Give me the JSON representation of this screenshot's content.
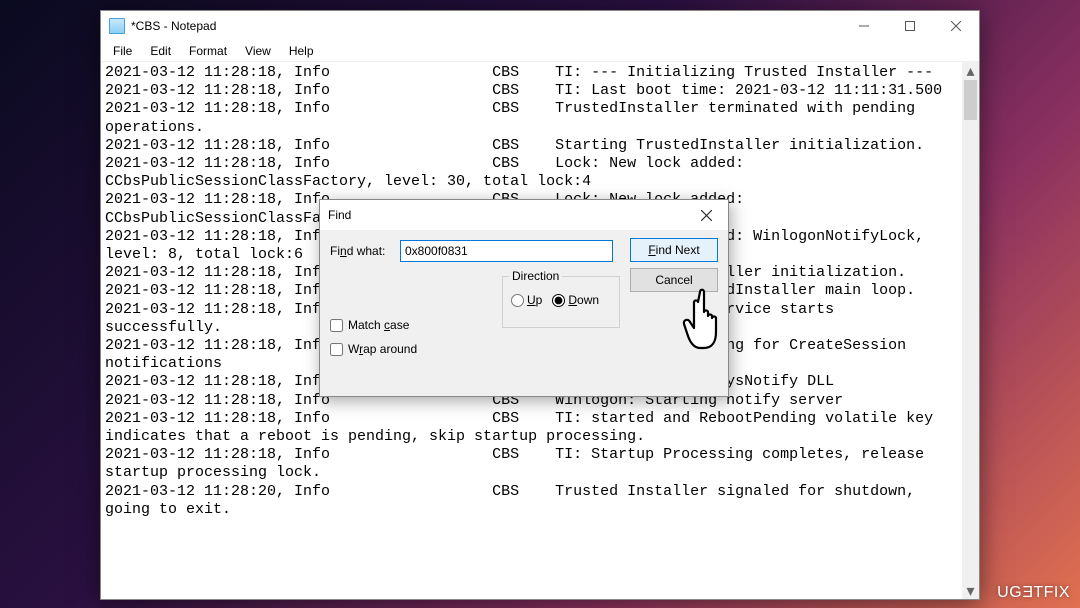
{
  "window": {
    "title": "*CBS - Notepad"
  },
  "menu": {
    "file": "File",
    "edit": "Edit",
    "format": "Format",
    "view": "View",
    "help": "Help"
  },
  "text": "2021-03-12 11:28:18, Info                  CBS    TI: --- Initializing Trusted Installer ---\n2021-03-12 11:28:18, Info                  CBS    TI: Last boot time: 2021-03-12 11:11:31.500\n2021-03-12 11:28:18, Info                  CBS    TrustedInstaller terminated with pending\noperations.\n2021-03-12 11:28:18, Info                  CBS    Starting TrustedInstaller initialization.\n2021-03-12 11:28:18, Info                  CBS    Lock: New lock added:\nCCbsPublicSessionClassFactory, level: 30, total lock:4\n2021-03-12 11:28:18, Info                  CBS    Lock: New lock added:\nCCbsPublicSessionClassFactory, level: 30, total lock:5\n2021-03-12 11:28:18, Info                  CBS    Lock: New lock added: WinlogonNotifyLock,\nlevel: 8, total lock:6\n2021-03-12 11:28:18, Info                  CBS    Ending TrustedInstaller initialization.\n2021-03-12 11:28:18, Info                  CBS    Starting the TrustedInstaller main loop.\n2021-03-12 11:28:18, Info                  CBS    TrustedInstaller service starts\nsuccessfully.\n2021-03-12 11:28:18, Info                  CBS    Winlogon: Registering for CreateSession\nnotifications\n2021-03-12 11:28:18, Info                  CBS    Winlogon: Loading SysNotify DLL\n2021-03-12 11:28:18, Info                  CBS    Winlogon: Starting notify server\n2021-03-12 11:28:18, Info                  CBS    TI: started and RebootPending volatile key\nindicates that a reboot is pending, skip startup processing.\n2021-03-12 11:28:18, Info                  CBS    TI: Startup Processing completes, release\nstartup processing lock.\n2021-03-12 11:28:20, Info                  CBS    Trusted Installer signaled for shutdown,\ngoing to exit.",
  "find": {
    "title": "Find",
    "label": "Find what:",
    "value": "0x800f0831",
    "findnext": "Find Next",
    "cancel": "Cancel",
    "direction_label": "Direction",
    "up": "Up",
    "down": "Down",
    "matchcase": "Match case",
    "wraparound": "Wrap around"
  },
  "watermark": "UGETFIX"
}
